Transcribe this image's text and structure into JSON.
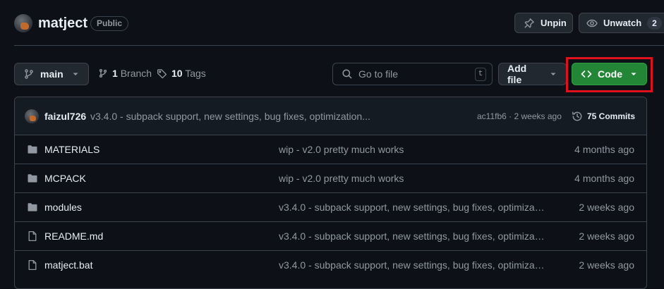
{
  "repo": {
    "name": "matject",
    "visibility": "Public"
  },
  "actions": {
    "unpin_label": "Unpin",
    "unwatch_label": "Unwatch",
    "watch_count": "2"
  },
  "toolbar": {
    "branch": "main",
    "branch_count": "1",
    "branch_label": "Branch",
    "tag_count": "10",
    "tag_label": "Tags",
    "search_placeholder": "Go to file",
    "search_shortcut": "t",
    "add_file_label": "Add file",
    "code_label": "Code"
  },
  "latest_commit": {
    "author": "faizul726",
    "message": "v3.4.0 - subpack support, new settings, bug fixes, optimization...",
    "hash": "ac11fb6",
    "time": "2 weeks ago",
    "commits_label": "75 Commits"
  },
  "files": [
    {
      "type": "folder",
      "name": "MATERIALS",
      "message": "wip - v2.0 pretty much works",
      "date": "4 months ago"
    },
    {
      "type": "folder",
      "name": "MCPACK",
      "message": "wip - v2.0 pretty much works",
      "date": "4 months ago"
    },
    {
      "type": "folder",
      "name": "modules",
      "message": "v3.4.0 - subpack support, new settings, bug fixes, optimizati...",
      "date": "2 weeks ago"
    },
    {
      "type": "file",
      "name": "README.md",
      "message": "v3.4.0 - subpack support, new settings, bug fixes, optimizati...",
      "date": "2 weeks ago"
    },
    {
      "type": "file",
      "name": "matject.bat",
      "message": "v3.4.0 - subpack support, new settings, bug fixes, optimizati...",
      "date": "2 weeks ago"
    }
  ],
  "colors": {
    "code_button": "#238636",
    "highlight_box": "#e0101c",
    "background": "#0d1117"
  }
}
